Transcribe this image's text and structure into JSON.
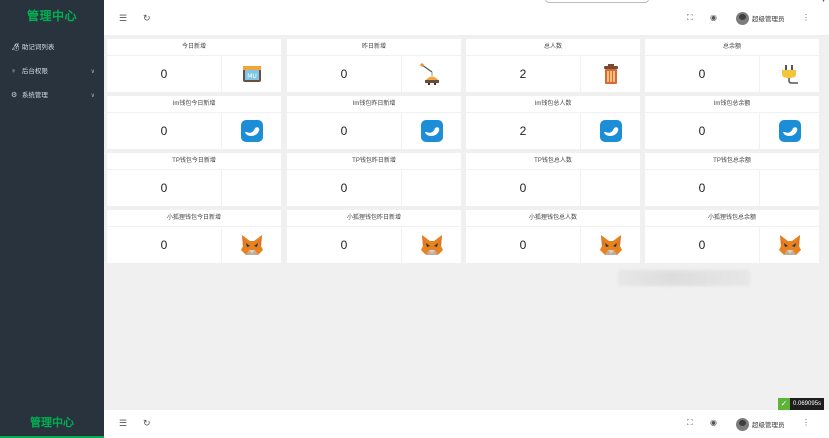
{
  "app": {
    "title": "管理中心"
  },
  "sidebar": {
    "items": [
      {
        "label": "助记词列表",
        "icon": "lock-icon"
      },
      {
        "label": "后台权限",
        "icon": "user-icon"
      },
      {
        "label": "系统管理",
        "icon": "gear-icon"
      }
    ]
  },
  "header": {
    "user_name": "超级管理员"
  },
  "footer": {
    "brand": "管理中心",
    "user_name": "超级管理员",
    "timing": "0.069095s"
  },
  "cards": [
    {
      "title": "今日新增",
      "value": "0",
      "icon": "calendar-icon"
    },
    {
      "title": "昨日新增",
      "value": "0",
      "icon": "fishing-icon"
    },
    {
      "title": "总人数",
      "value": "2",
      "icon": "trash-can-icon"
    },
    {
      "title": "总余额",
      "value": "0",
      "icon": "plug-icon"
    },
    {
      "title": "Im钱包今日新增",
      "value": "0",
      "icon": "imtoken-icon"
    },
    {
      "title": "Im钱包昨日新增",
      "value": "0",
      "icon": "imtoken-icon"
    },
    {
      "title": "Im钱包总人数",
      "value": "2",
      "icon": "imtoken-icon"
    },
    {
      "title": "Im钱包总余额",
      "value": "0",
      "icon": "imtoken-icon"
    },
    {
      "title": "TP钱包今日新增",
      "value": "0",
      "icon": ""
    },
    {
      "title": "TP钱包昨日新增",
      "value": "0",
      "icon": ""
    },
    {
      "title": "TP钱包总人数",
      "value": "0",
      "icon": ""
    },
    {
      "title": "TP钱包总余额",
      "value": "0",
      "icon": ""
    },
    {
      "title": "小狐狸钱包今日新增",
      "value": "0",
      "icon": "metamask-fox-icon"
    },
    {
      "title": "小狐狸钱包昨日新增",
      "value": "0",
      "icon": "metamask-fox-icon"
    },
    {
      "title": "小狐狸钱包总人数",
      "value": "0",
      "icon": "metamask-fox-icon"
    },
    {
      "title": "小狐狸钱包总余额",
      "value": "0",
      "icon": "metamask-fox-icon"
    }
  ],
  "colors": {
    "sidebar": "#28333e",
    "brand": "#00b050",
    "imtoken": "#1c8ed8",
    "fox": "#e8821e"
  }
}
